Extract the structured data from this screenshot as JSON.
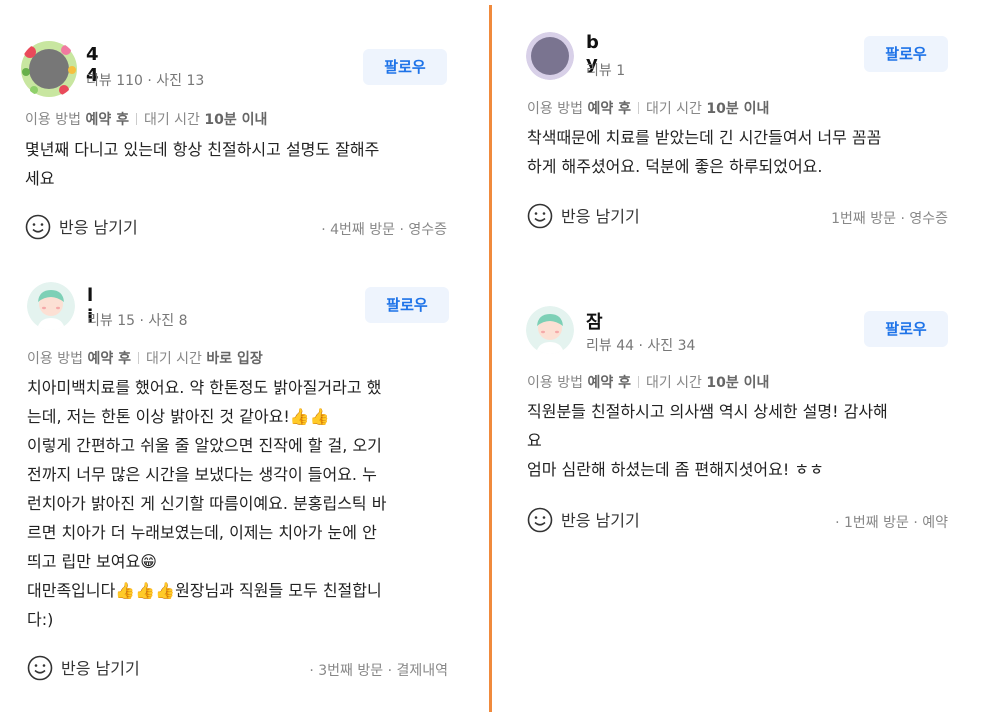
{
  "follow_label": "팔로우",
  "react_label": "반응 남기기",
  "reviews": [
    {
      "name": "4  4",
      "meta": "리뷰 110 · 사진 13",
      "info": {
        "method_label": "이용 방법",
        "method": "예약 후",
        "wait_label": "대기 시간",
        "wait": "10분 이내"
      },
      "lines": [
        "몇년째 다니고 있는데 항상 친절하시고 설명도 잘해주",
        "세요"
      ],
      "visit": "· 4번째 방문 · 영수증"
    },
    {
      "name": "l       i",
      "meta": "리뷰 15 · 사진 8",
      "info": {
        "method_label": "이용 방법",
        "method": "예약 후",
        "wait_label": "대기 시간",
        "wait": "바로 입장"
      },
      "lines": [
        "치아미백치료를 했어요. 약 한톤정도 밝아질거라고 했",
        "는데, 저는 한톤 이상 밝아진 것 같아요!👍👍",
        "이렇게 간편하고 쉬울 줄 알았으면 진작에 할 걸, 오기",
        "전까지 너무 많은 시간을 보냈다는 생각이 들어요. 누",
        "런치아가 밝아진 게 신기할 따름이예요. 분홍립스틱 바",
        "르면 치아가 더 누래보였는데, 이제는 치아가 눈에 안",
        "띄고 립만 보여요😁",
        "대만족입니다👍👍👍원장님과 직원들 모두 친절합니",
        "다:)"
      ],
      "visit": "· 3번째 방문 · 결제내역"
    },
    {
      "name": "b          y",
      "meta": "리뷰 1",
      "info": {
        "method_label": "이용 방법",
        "method": "예약 후",
        "wait_label": "대기 시간",
        "wait": "10분 이내"
      },
      "lines": [
        "착색때문에 치료를 받았는데 긴 시간들여서 너무 꼼꼼",
        "하게 해주셨어요. 덕분에 좋은 하루되었어요."
      ],
      "visit": "1번째 방문 · 영수증"
    },
    {
      "name": "잠        ",
      "meta": "리뷰 44 · 사진 34",
      "info": {
        "method_label": "이용 방법",
        "method": "예약 후",
        "wait_label": "대기 시간",
        "wait": "10분 이내"
      },
      "lines": [
        "직원분들 친절하시고 의사쌤 역시 상세한 설명! 감사해",
        "요",
        "엄마 심란해 하셨는데 좀 편해지셧어요! ㅎㅎ"
      ],
      "visit": "· 1번째 방문 · 예약"
    }
  ]
}
